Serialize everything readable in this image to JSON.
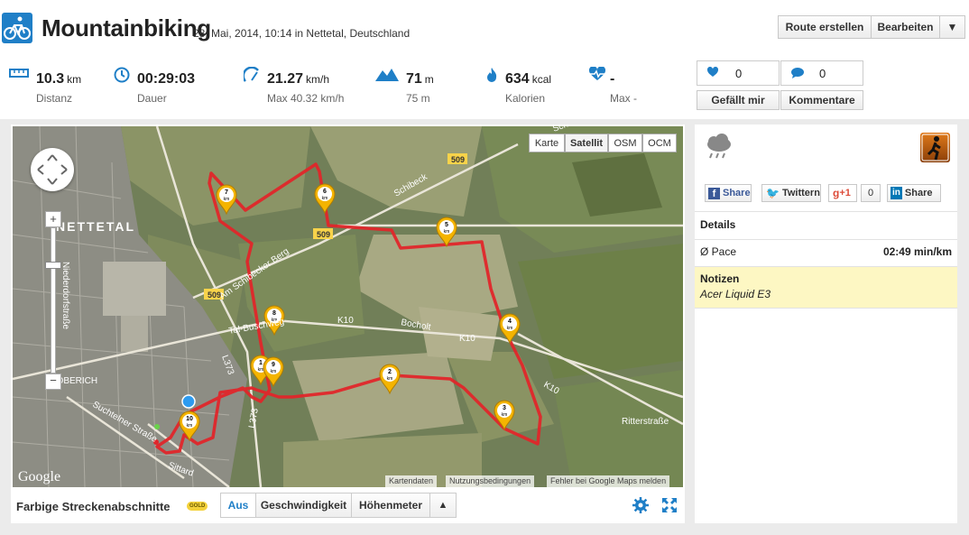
{
  "header": {
    "title": "Mountainbiking",
    "subtitle": "28. Mai, 2014, 10:14 in Nettetal, Deutschland",
    "activity_icon": "bicycle-icon",
    "buttons": {
      "create_route": "Route erstellen",
      "edit": "Bearbeiten",
      "more": "▼"
    }
  },
  "stats": [
    {
      "icon": "distance-ruler-icon",
      "value": "10.3",
      "unit": "km",
      "label": "Distanz"
    },
    {
      "icon": "clock-icon",
      "value": "00:29:03",
      "unit": "",
      "label": "Dauer"
    },
    {
      "icon": "speedometer-icon",
      "value": "21.27",
      "unit": "km/h",
      "label": "Max 40.32 km/h"
    },
    {
      "icon": "mountain-icon",
      "value": "71",
      "unit": "m",
      "label": "75 m"
    },
    {
      "icon": "flame-icon",
      "value": "634",
      "unit": "kcal",
      "label": "Kalorien"
    },
    {
      "icon": "heart-rate-icon",
      "value": "-",
      "unit": "",
      "label": "Max -"
    }
  ],
  "social": {
    "likes": "0",
    "comments": "0",
    "like_label": "Gefällt mir",
    "comment_label": "Kommentare"
  },
  "map": {
    "types": [
      "Karte",
      "Satellit",
      "OSM",
      "OCM"
    ],
    "selected_type": "Satellit",
    "town_label": "NETTETAL",
    "road_labels": {
      "r509_a": "509",
      "r509_b": "509",
      "r509_c": "509",
      "l373": "L373",
      "k10_a": "K10",
      "k10_b": "K10",
      "k10_c": "K10",
      "schibeck": "Schibeck",
      "schibecker_berg": "Am Schibecker Berg",
      "tal_weg": "Tal-Buschweg",
      "bocholt": "Bocholt",
      "nieder": "Niederdorfstraße",
      "suchteln": "Suchtelner Straße",
      "sittard": "Sittard",
      "ritter": "Ritterstraße",
      "lobe": "LOBERICH",
      "schi": "Schi..."
    },
    "markers": [
      "1 km",
      "2 km",
      "3 km",
      "4 km",
      "5 km",
      "6 km",
      "7 km",
      "8 km",
      "9 km",
      "10 km"
    ],
    "marker_nums": [
      "1",
      "2",
      "3",
      "4",
      "5",
      "6",
      "7",
      "8",
      "9",
      "10"
    ],
    "marker_unit": "km",
    "google": "Google",
    "attribution": [
      "Kartendaten",
      "Nutzungsbedingungen",
      "Fehler bei Google Maps melden"
    ],
    "route_color": "#e0262a"
  },
  "map_footer": {
    "label": "Farbige Streckenabschnitte",
    "badge": "GOLD",
    "tabs": [
      "Aus",
      "Geschwindigkeit",
      "Höhenmeter"
    ],
    "selected_tab": "Aus",
    "collapse": "▲"
  },
  "side": {
    "weather_icon": "rain-cloud-icon",
    "app_icon": "runner-app-icon",
    "share": {
      "facebook": "Share",
      "twitter": "Twittern",
      "gplus": "+1",
      "gplus_count": "0",
      "linkedin": "Share"
    },
    "details_heading": "Details",
    "pace_label": "Ø Pace",
    "pace_value": "02:49 min/km",
    "notes_heading": "Notizen",
    "notes_text": "Acer Liquid E3"
  },
  "colors": {
    "accent": "#1f7fc7",
    "route": "#e0262a",
    "marker": "#f4b400",
    "notes_bg": "#fdf7c3"
  }
}
